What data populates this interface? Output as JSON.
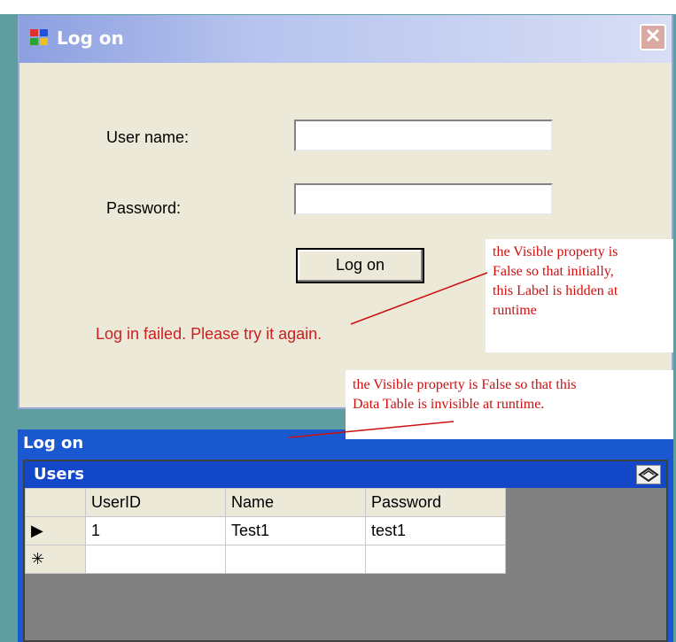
{
  "logon_form": {
    "title": "Log on",
    "username_label": "User name:",
    "username_value": "",
    "password_label": "Password:",
    "password_value": "",
    "logon_button": "Log on",
    "fail_message": "Log in failed. Please try it again."
  },
  "annotations": {
    "label_note": [
      "the Visible property is",
      "False so that initially,",
      "this Label is hidden at",
      "runtime"
    ],
    "table_note": [
      "the Visible property is False so that this",
      "Data Table is invisible at runtime."
    ]
  },
  "data_window": {
    "title": "Log on",
    "grid_caption": "Users",
    "columns": [
      "UserID",
      "Name",
      "Password"
    ],
    "rows": [
      {
        "marker": "▶",
        "cells": [
          "1",
          "Test1",
          "test1"
        ]
      },
      {
        "marker": "✳",
        "cells": [
          "",
          "",
          ""
        ]
      }
    ]
  },
  "colors": {
    "fail_text": "#cc2020",
    "note_text": "#cc1010",
    "data_window_bg": "#1a58d0"
  }
}
